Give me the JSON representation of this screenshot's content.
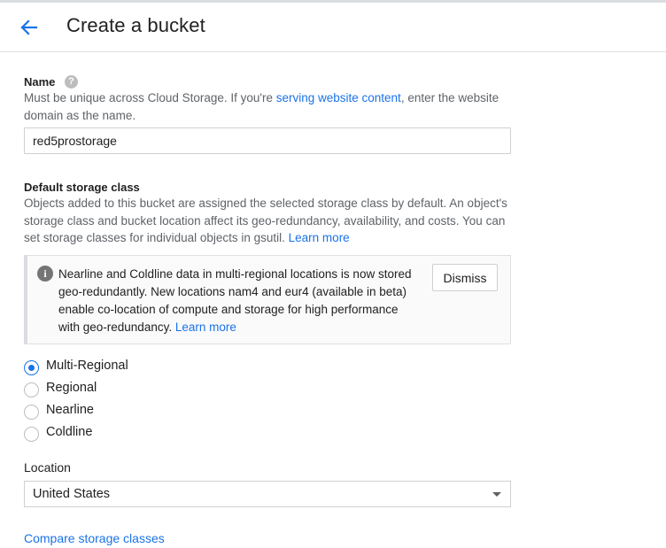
{
  "header": {
    "back_icon": "arrow-back-icon",
    "title": "Create a bucket"
  },
  "name_section": {
    "label": "Name",
    "help_icon": "help-circle-icon",
    "help_glyph": "?",
    "desc_before": "Must be unique across Cloud Storage. If you're ",
    "desc_link": "serving website content",
    "desc_after": ", enter the website domain as the name.",
    "input_value": "red5prostorage"
  },
  "storage_class": {
    "label": "Default storage class",
    "desc_before": "Objects added to this bucket are assigned the selected storage class by default. An object's storage class and bucket location affect its geo-redundancy, availability, and costs. You can set storage classes for individual objects in gsutil. ",
    "desc_link": "Learn more",
    "notice": {
      "icon": "info-icon",
      "icon_glyph": "i",
      "text": "Nearline and Coldline data in multi-regional locations is now stored geo-redundantly. New locations nam4 and eur4 (available in beta) enable co-location of compute and storage for high performance with geo-redundancy. ",
      "link": "Learn more",
      "dismiss_label": "Dismiss"
    },
    "options": [
      {
        "label": "Multi-Regional",
        "checked": true
      },
      {
        "label": "Regional",
        "checked": false
      },
      {
        "label": "Nearline",
        "checked": false
      },
      {
        "label": "Coldline",
        "checked": false
      }
    ]
  },
  "location": {
    "label": "Location",
    "selected": "United States",
    "dropdown_icon": "caret-down-icon"
  },
  "compare_link": "Compare storage classes",
  "colors": {
    "accent": "#1a73e8",
    "text": "#212121",
    "secondary_text": "#5f6368"
  }
}
